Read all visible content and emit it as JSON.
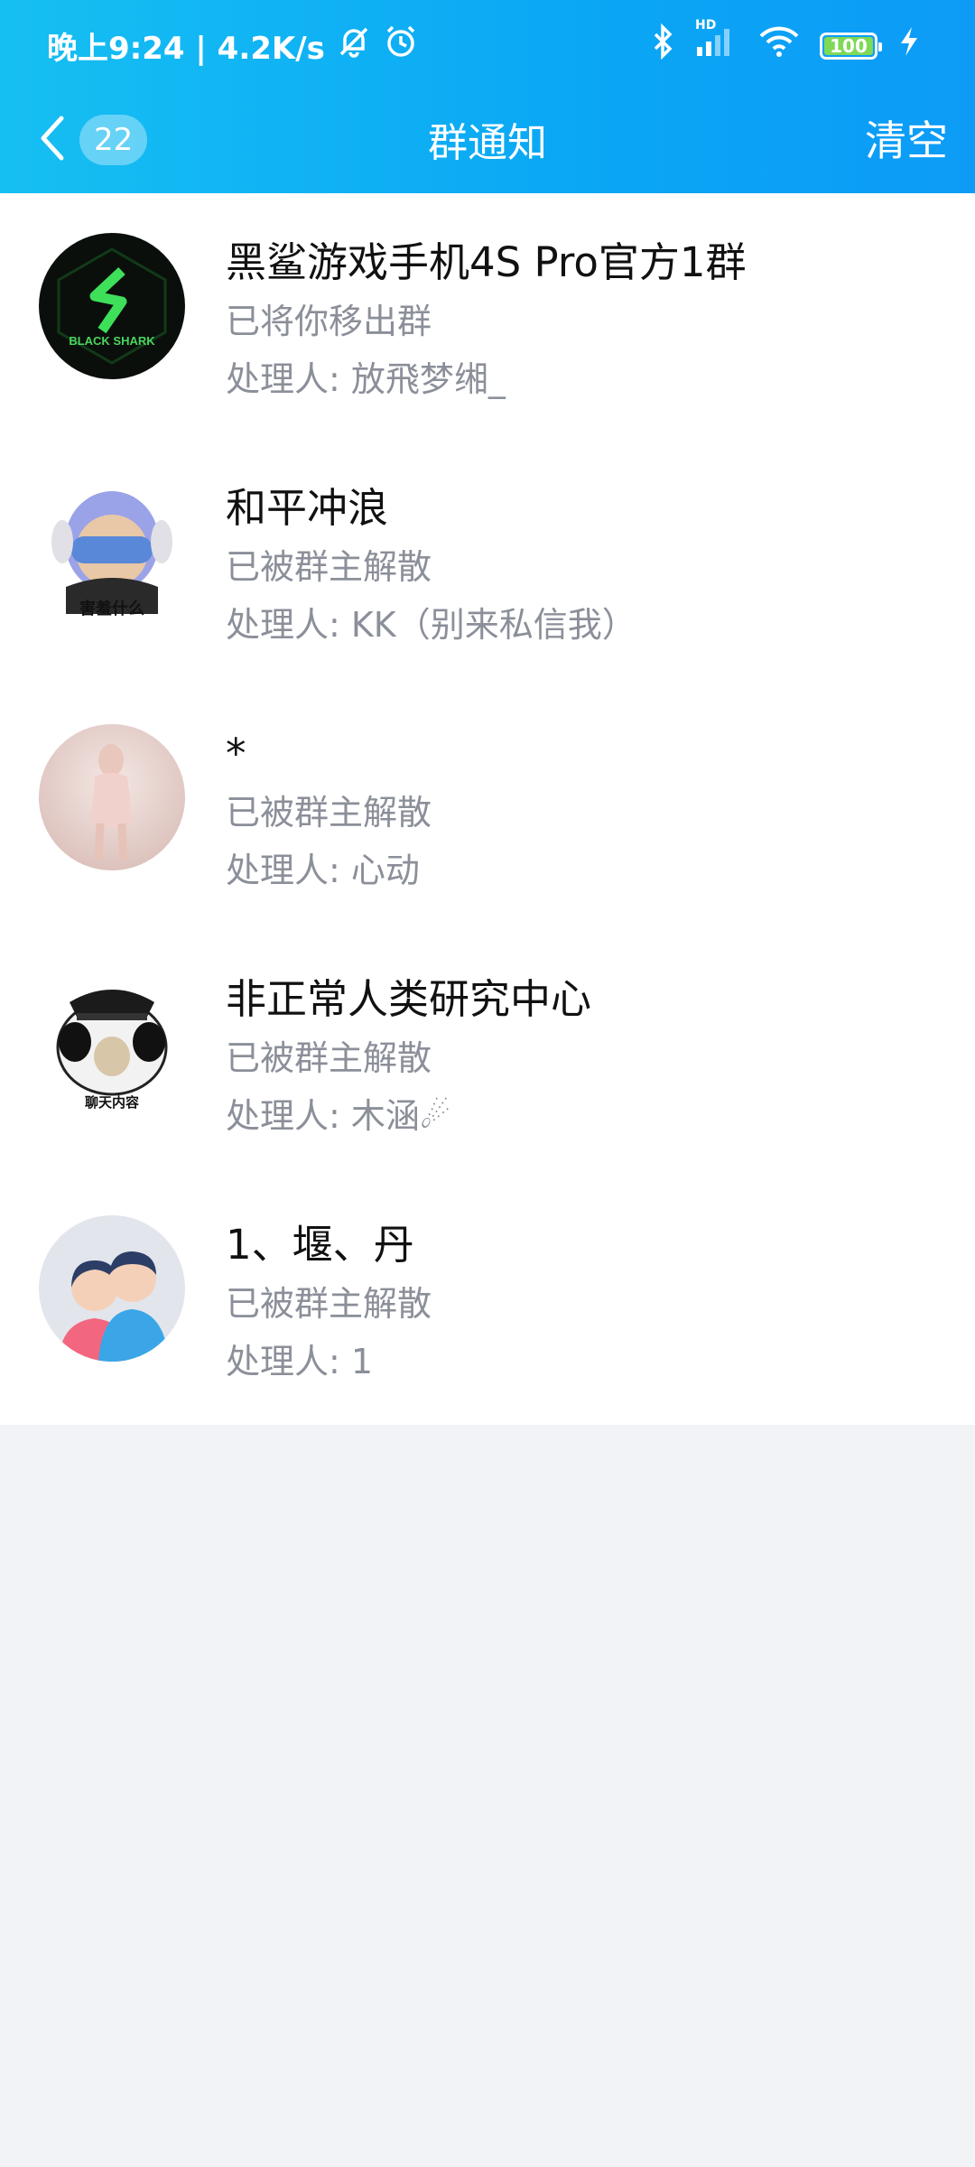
{
  "status_bar": {
    "time_speed": "晚上9:24 | 4.2K/s",
    "battery": "100",
    "network_label": "HD"
  },
  "nav": {
    "back_count": "22",
    "title": "群通知",
    "clear_label": "清空"
  },
  "notifications": [
    {
      "group_name": "黑鲨游戏手机4S Pro官方1群",
      "status": "已将你移出群",
      "handler": "处理人: 放飛梦缃_",
      "avatar_text": "BLACK SHARK"
    },
    {
      "group_name": "和平冲浪",
      "status": "已被群主解散",
      "handler": "处理人: KK（别来私信我）",
      "avatar_text": "害羞什么"
    },
    {
      "group_name": "*",
      "status": "已被群主解散",
      "handler": "处理人: 心动"
    },
    {
      "group_name": "非正常人类研究中心",
      "status": "已被群主解散",
      "handler": "处理人: 木涵☄",
      "avatar_text": "聊天内容"
    },
    {
      "group_name": "1、堰、丹",
      "status": "已被群主解散",
      "handler": "处理人: 1"
    }
  ]
}
